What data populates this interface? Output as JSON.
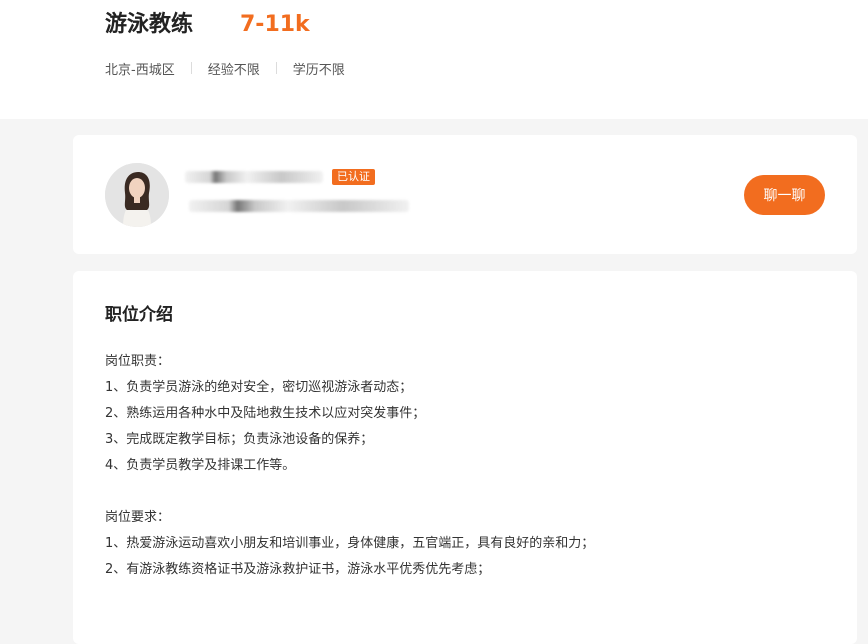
{
  "job": {
    "title": "游泳教练",
    "salary": "7-11k",
    "tags": [
      "北京-西城区",
      "经验不限",
      "学历不限"
    ]
  },
  "recruiter": {
    "verified_badge": "已认证",
    "chat_button": "聊一聊"
  },
  "description": {
    "section_title": "职位介绍",
    "duties_heading": "岗位职责：",
    "duties": [
      "1、负责学员游泳的绝对安全，密切巡视游泳者动态；",
      "2、熟练运用各种水中及陆地救生技术以应对突发事件；",
      "3、完成既定教学目标；负责泳池设备的保养；",
      "4、负责学员教学及排课工作等。"
    ],
    "requirements_heading": "岗位要求：",
    "requirements": [
      "1、热爱游泳运动喜欢小朋友和培训事业，身体健康，五官端正，具有良好的亲和力；",
      "2、有游泳教练资格证书及游泳救护证书，游泳水平优秀优先考虑；"
    ]
  },
  "colors": {
    "accent": "#f26d1f",
    "page_bg": "#f5f5f5"
  }
}
